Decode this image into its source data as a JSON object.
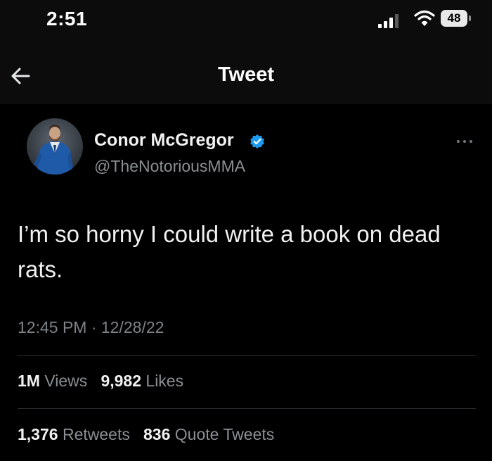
{
  "status_bar": {
    "time": "2:51",
    "battery": "48",
    "icons": [
      "signal-icon",
      "wifi-icon",
      "battery-icon"
    ]
  },
  "header": {
    "title": "Tweet",
    "back_icon": "arrow-left-icon"
  },
  "tweet": {
    "author_name": "Conor McGregor",
    "author_handle": "@TheNotoriousMMA",
    "verified_icon": "verified-badge-icon",
    "more_icon": "more-options-icon",
    "text": "I’m so horny I could write a book on dead rats.",
    "timestamp": "12:45 PM · 12/28/22"
  },
  "stats": {
    "views": {
      "value": "1M",
      "label": "Views"
    },
    "likes": {
      "value": "9,982",
      "label": "Likes"
    },
    "retweets": {
      "value": "1,376",
      "label": "Retweets"
    },
    "quote_tweets": {
      "value": "836",
      "label": "Quote Tweets"
    }
  },
  "colors": {
    "background": "#000000",
    "header_background": "#0c0c0d",
    "primary_text": "#f2f2f2",
    "secondary_text": "#8b8f93",
    "verified_blue": "#1d9bf0",
    "divider": "#2a2d30"
  }
}
